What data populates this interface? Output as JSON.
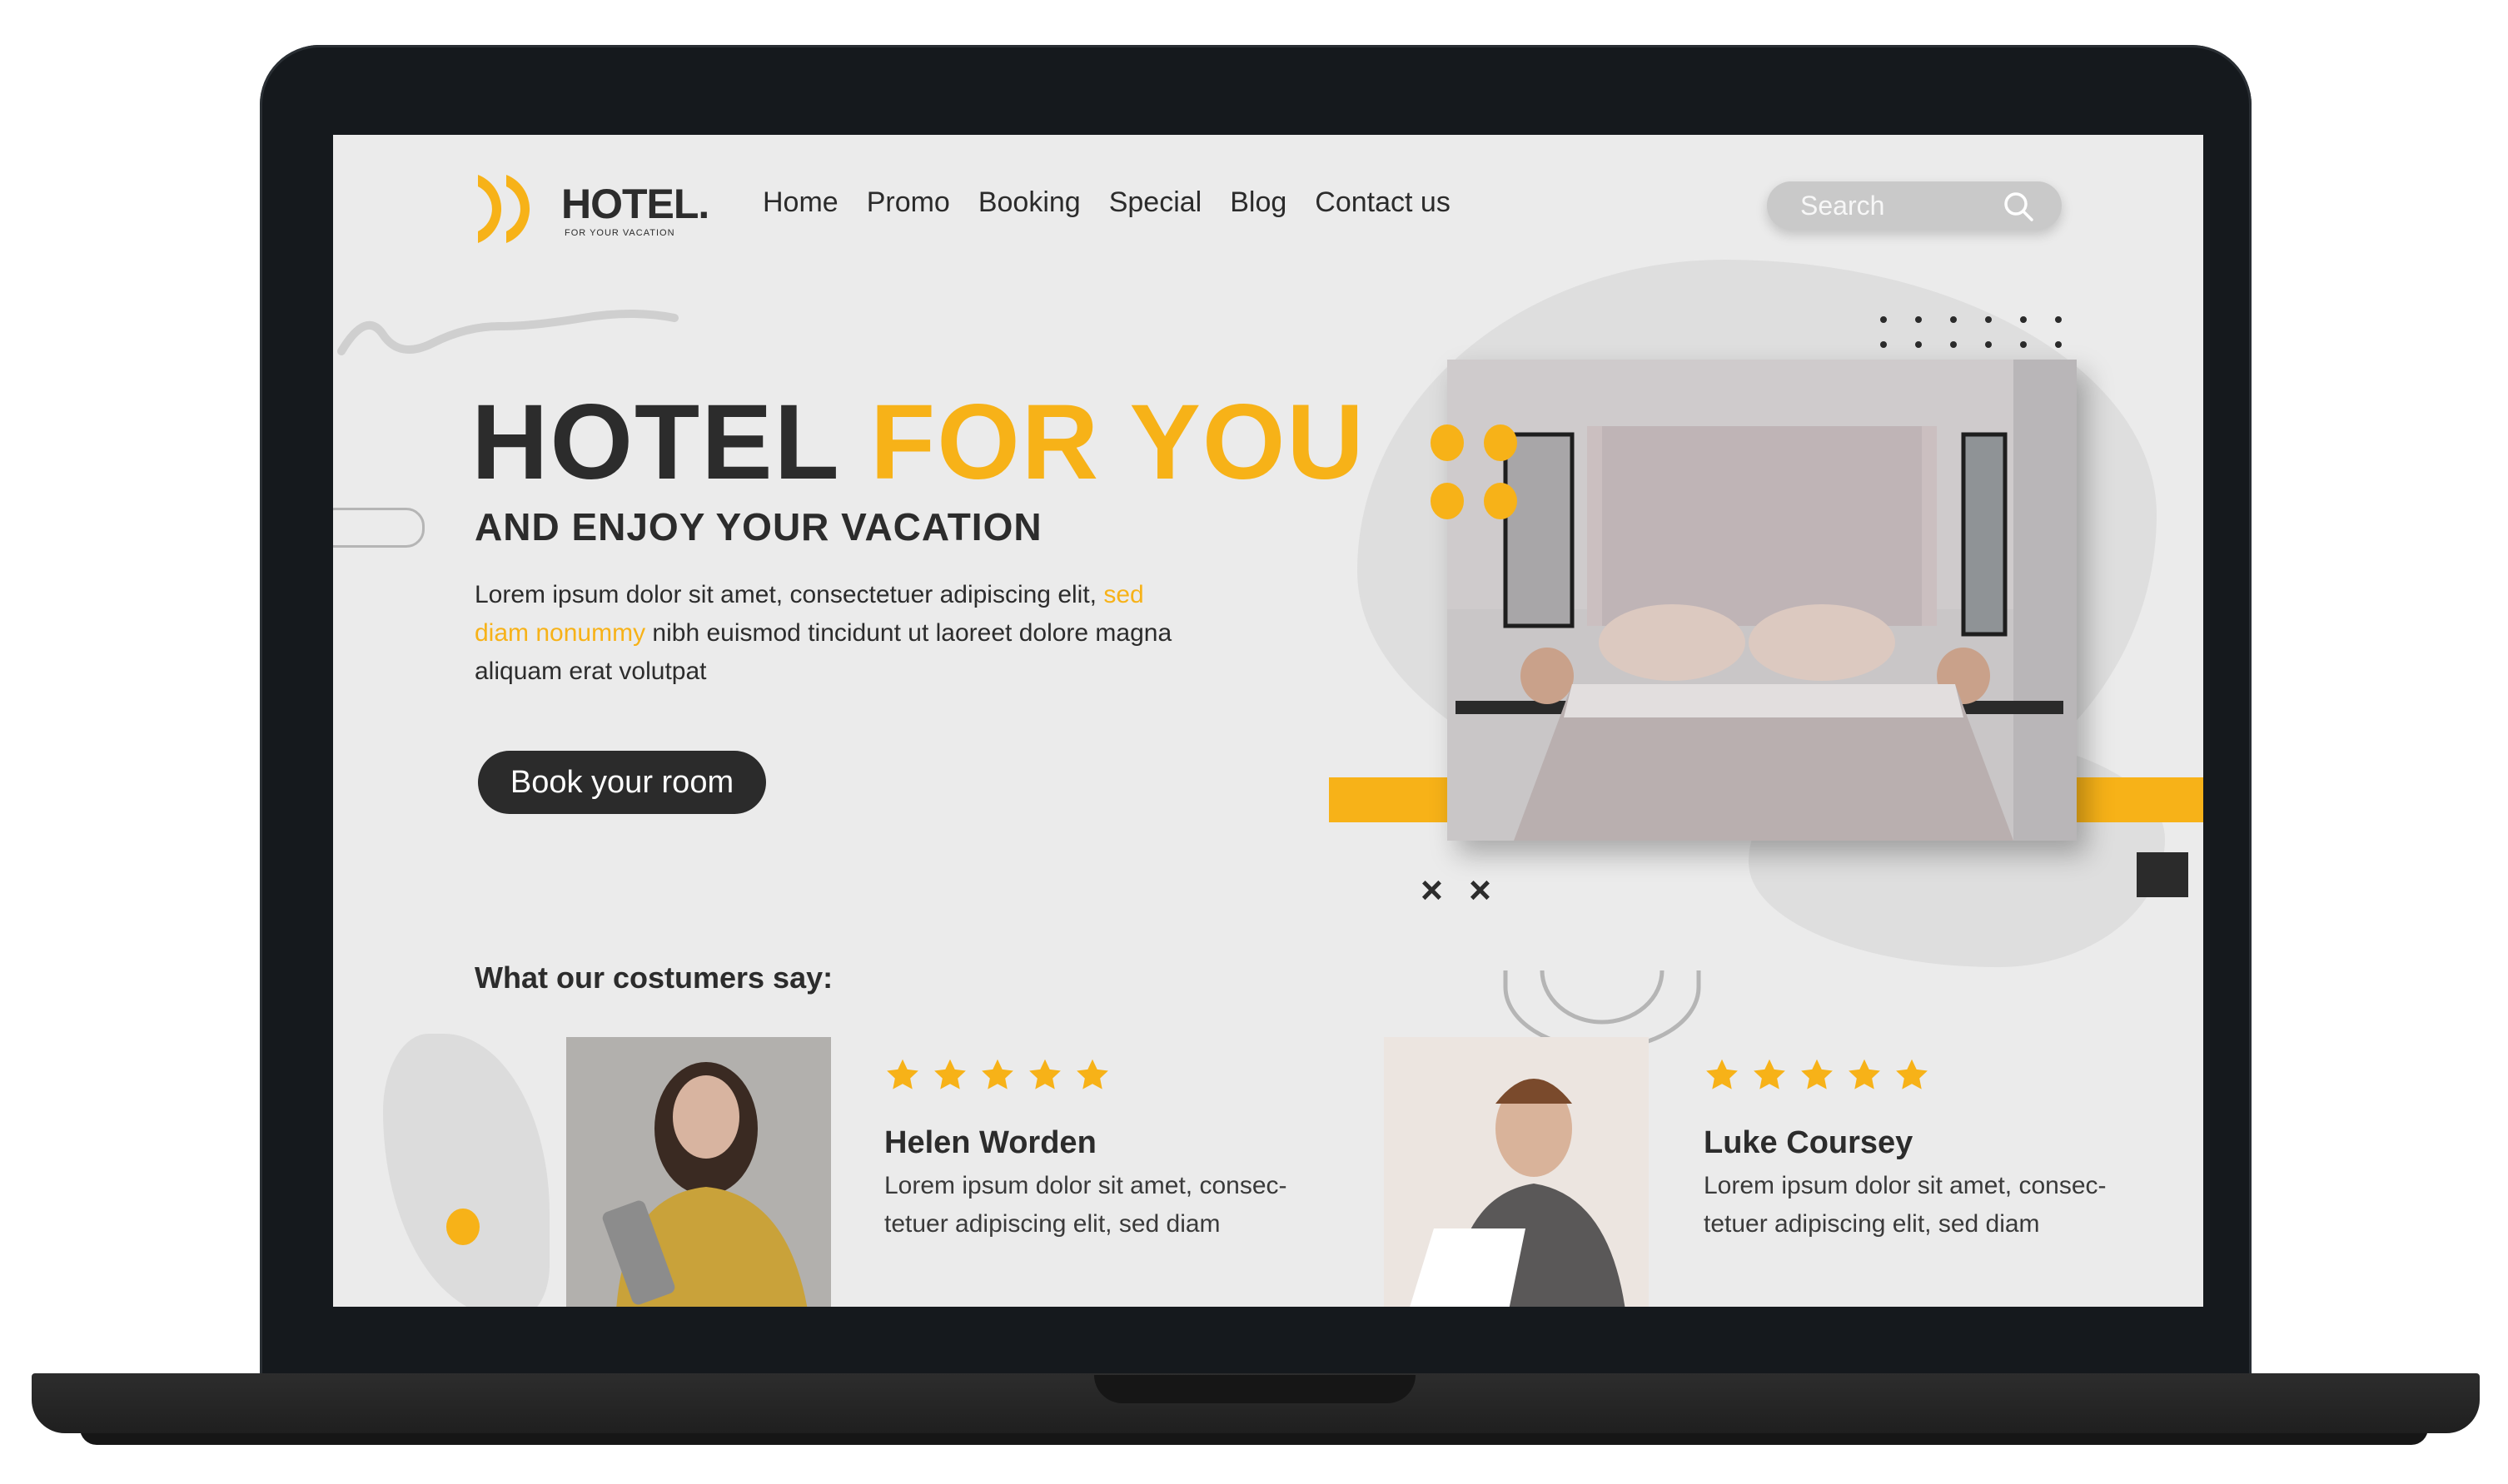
{
  "brand": {
    "name": "HOTEL.",
    "tagline": "FOR YOUR VACATION",
    "accent_color": "#f7b218",
    "dark_color": "#2b2b2b"
  },
  "nav": {
    "items": [
      "Home",
      "Promo",
      "Booking",
      "Special",
      "Blog",
      "Contact us"
    ]
  },
  "search": {
    "placeholder": "Search",
    "icon": "search-icon"
  },
  "hero": {
    "title_part1": "HOTEL",
    "title_part2": "FOR YOU",
    "subtitle": "AND ENJOY YOUR VACATION",
    "desc_line1": "Lorem ipsum dolor sit amet, consectetuer adipiscing elit,",
    "desc_highlight": "sed diam nonummy",
    "desc_rest": "nibh euismod tincidunt ut laoreet dolore magna aliquam erat volutpat",
    "cta_label": "Book your room",
    "close_marks": [
      "×",
      "×"
    ]
  },
  "testimonials": {
    "heading": "What our costumers say:",
    "items": [
      {
        "name": "Helen Worden",
        "rating": 5,
        "text_line1": "Lorem ipsum dolor sit amet, consec-",
        "text_line2": "tetuer adipiscing elit, sed diam"
      },
      {
        "name": "Luke Coursey",
        "rating": 5,
        "text_line1": "Lorem ipsum dolor sit amet, consec-",
        "text_line2": "tetuer adipiscing elit, sed diam"
      }
    ]
  }
}
